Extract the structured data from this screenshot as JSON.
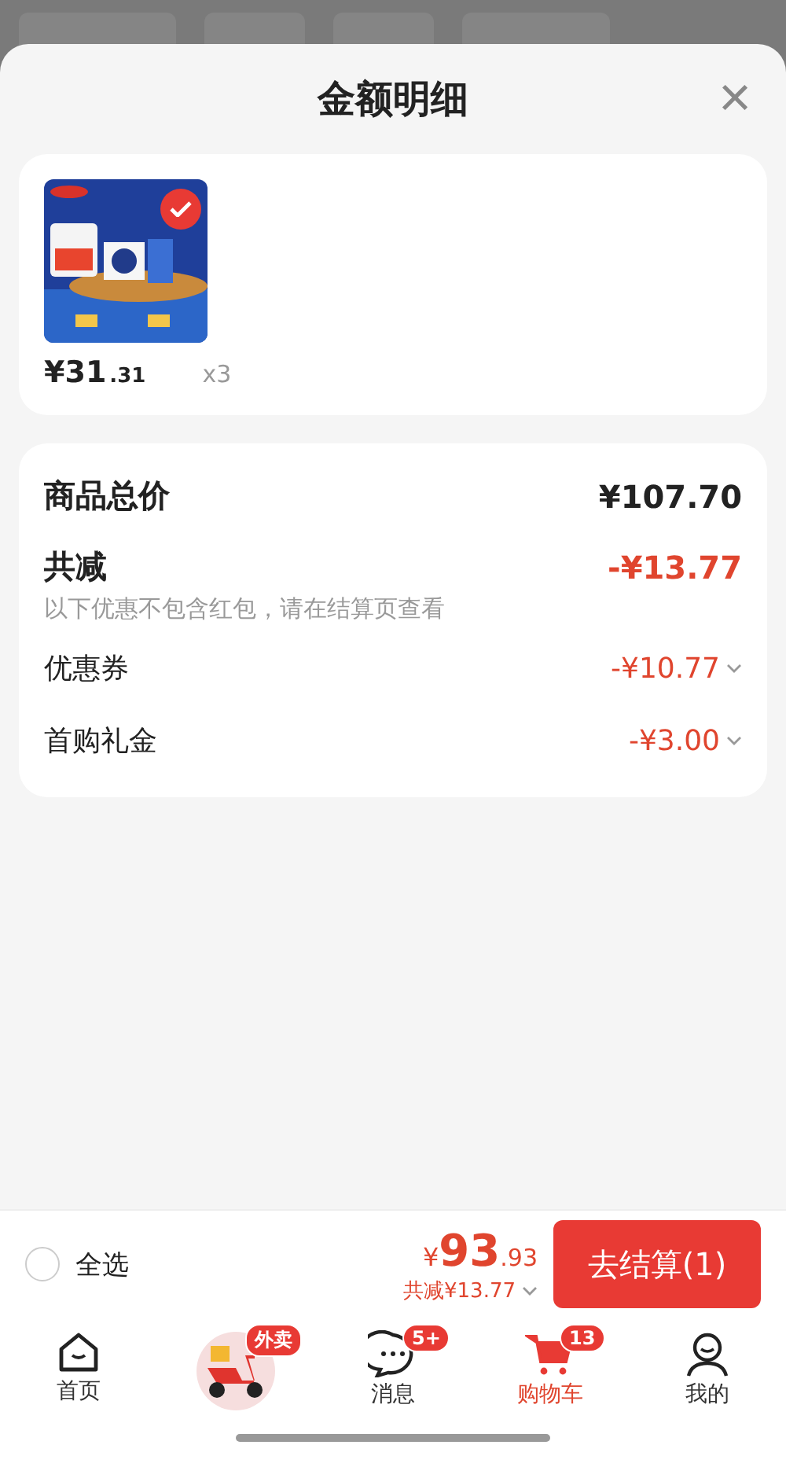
{
  "sheet": {
    "title": "金额明细",
    "close": "×"
  },
  "product": {
    "checked": true,
    "price_main": "¥31",
    "price_decimal": ".31",
    "quantity": "x3"
  },
  "summary": {
    "total_label": "商品总价",
    "total_value": "¥107.70",
    "discount_label": "共减",
    "discount_value": "-¥13.77",
    "note": "以下优惠不包含红包，请在结算页查看",
    "items": [
      {
        "label": "优惠券",
        "value": "-¥10.77"
      },
      {
        "label": "首购礼金",
        "value": "-¥3.00"
      }
    ]
  },
  "checkout": {
    "select_all": "全选",
    "checked": false,
    "currency": "¥",
    "amount_main": "93",
    "amount_decimal": ".93",
    "saved": "共减¥13.77",
    "button": "去结算(1)"
  },
  "nav": [
    {
      "kind": "home",
      "label": "首页",
      "selected": false
    },
    {
      "kind": "delivery",
      "badge": "外卖",
      "selected": false
    },
    {
      "kind": "message",
      "label": "消息",
      "badge": "5+",
      "selected": false
    },
    {
      "kind": "cart",
      "label": "购物车",
      "badge": "13",
      "selected": true
    },
    {
      "kind": "profile",
      "label": "我的",
      "selected": false
    }
  ]
}
